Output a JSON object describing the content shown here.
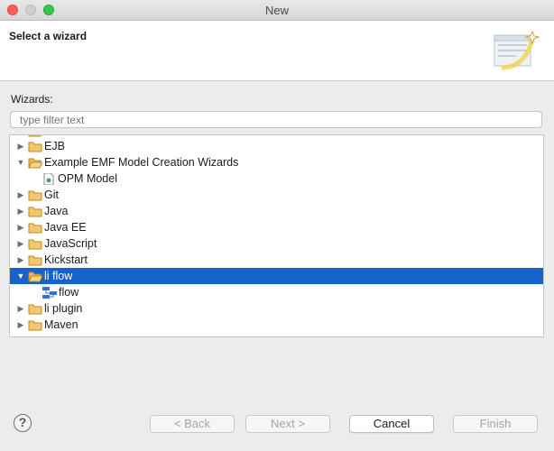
{
  "window": {
    "title": "New"
  },
  "header": {
    "title": "Select a wizard"
  },
  "wizards_label": "Wizards:",
  "filter": {
    "placeholder": "type filter text",
    "value": ""
  },
  "tree": {
    "items": [
      {
        "label": "EJB",
        "expanded": false,
        "icon": "folder-icon"
      },
      {
        "label": "Example EMF Model Creation Wizards",
        "expanded": true,
        "icon": "folder-open-icon"
      },
      {
        "label": "OPM Model",
        "icon": "emf-model-file-icon"
      },
      {
        "label": "Git",
        "expanded": false,
        "icon": "folder-icon"
      },
      {
        "label": "Java",
        "expanded": false,
        "icon": "folder-icon"
      },
      {
        "label": "Java EE",
        "expanded": false,
        "icon": "folder-icon"
      },
      {
        "label": "JavaScript",
        "expanded": false,
        "icon": "folder-icon"
      },
      {
        "label": "Kickstart",
        "expanded": false,
        "icon": "folder-icon"
      },
      {
        "label": "li flow",
        "expanded": true,
        "selected": true,
        "icon": "folder-open-icon"
      },
      {
        "label": "flow",
        "icon": "flow-diagram-icon"
      },
      {
        "label": "li plugin",
        "expanded": false,
        "icon": "folder-icon"
      },
      {
        "label": "Maven",
        "expanded": false,
        "icon": "folder-icon"
      }
    ]
  },
  "buttons": {
    "help": "?",
    "back": "< Back",
    "next": "Next >",
    "cancel": "Cancel",
    "finish": "Finish"
  },
  "colors": {
    "selection": "#1762c9",
    "close": "#fc5f57",
    "maximize": "#35c84a"
  }
}
